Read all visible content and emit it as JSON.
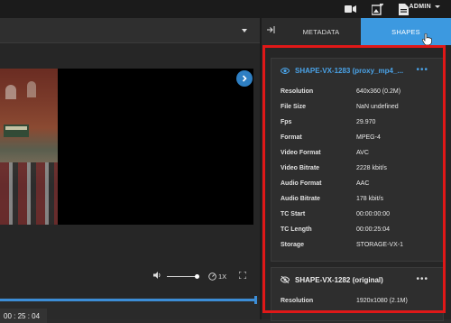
{
  "header": {
    "user_label": "ADMIN",
    "icons": [
      "video-camera-icon",
      "add-image-icon",
      "document-icon"
    ]
  },
  "player": {
    "timecode": "00 : 25 : 04",
    "speed": "1X"
  },
  "tabs": {
    "metadata": "METADATA",
    "shapes": "SHAPES"
  },
  "shapes": [
    {
      "title": "SHAPE-VX-1283 (proxy_mp4_...",
      "active": true,
      "rows": [
        {
          "label": "Resolution",
          "value": "640x360 (0.2M)"
        },
        {
          "label": "File Size",
          "value": "NaN undefined"
        },
        {
          "label": "Fps",
          "value": "29.970"
        },
        {
          "label": "Format",
          "value": "MPEG-4"
        },
        {
          "label": "Video Format",
          "value": "AVC"
        },
        {
          "label": "Video Bitrate",
          "value": "2228 kbit/s"
        },
        {
          "label": "Audio Format",
          "value": "AAC"
        },
        {
          "label": "Audio Bitrate",
          "value": "178 kbit/s"
        },
        {
          "label": "TC Start",
          "value": "00:00:00:00"
        },
        {
          "label": "TC Length",
          "value": "00:00:25:04"
        },
        {
          "label": "Storage",
          "value": "STORAGE-VX-1"
        }
      ]
    },
    {
      "title": "SHAPE-VX-1282 (original)",
      "active": false,
      "rows": [
        {
          "label": "Resolution",
          "value": "1920x1080 (2.1M)"
        }
      ]
    }
  ],
  "colors": {
    "accent": "#3c99e0",
    "highlight_box": "#e01818"
  }
}
